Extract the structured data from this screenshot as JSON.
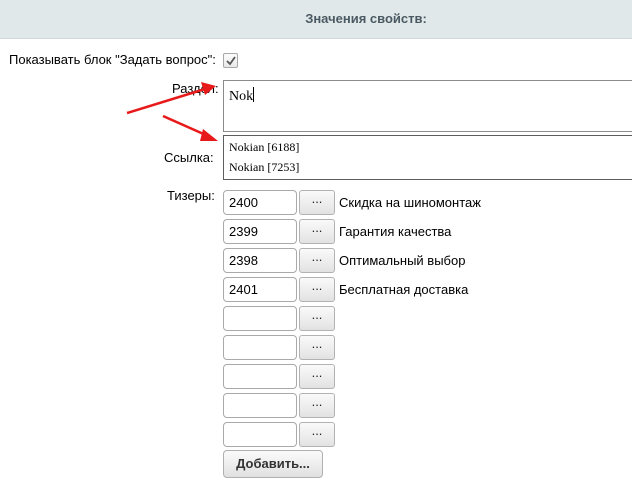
{
  "header": {
    "title": "Значения свойств:"
  },
  "form": {
    "show_question_label": "Показывать блок \"Задать вопрос\":",
    "show_question_checked": true,
    "section_label": "Раздел:",
    "section_value": "Nok",
    "link_label": "Ссылка:",
    "teasers_label": "Тизеры:",
    "suggestions": [
      "Nokian [6188]",
      "Nokian [7253]"
    ],
    "teasers": [
      {
        "id": "2400",
        "button": "...",
        "title": "Скидка на шиномонтаж"
      },
      {
        "id": "2399",
        "button": "...",
        "title": "Гарантия качества"
      },
      {
        "id": "2398",
        "button": "...",
        "title": "Оптимальный выбор"
      },
      {
        "id": "2401",
        "button": "...",
        "title": "Бесплатная доставка"
      },
      {
        "id": "",
        "button": "...",
        "title": ""
      },
      {
        "id": "",
        "button": "...",
        "title": ""
      },
      {
        "id": "",
        "button": "...",
        "title": ""
      },
      {
        "id": "",
        "button": "...",
        "title": ""
      },
      {
        "id": "",
        "button": "...",
        "title": ""
      }
    ],
    "add_button": "Добавить..."
  },
  "colors": {
    "header_bg": "#e0e8ea",
    "annotation_arrow": "#e8191a"
  }
}
